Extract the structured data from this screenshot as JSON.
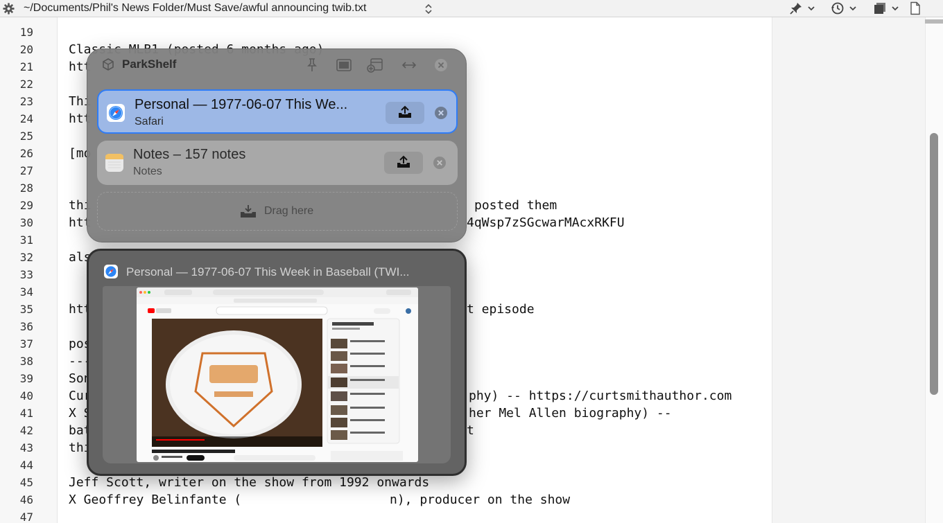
{
  "titlebar": {
    "path": "~/Documents/Phil's News Folder/Must Save/awful announcing twib.txt"
  },
  "editor": {
    "line_numbers": [
      "19",
      "20",
      "21",
      "22",
      "23",
      "24",
      "25",
      "26",
      "27",
      "28",
      "29",
      "30",
      "31",
      "32",
      "33",
      "34",
      "35",
      "36",
      "37",
      "38",
      "39",
      "40",
      "41",
      "42",
      "43",
      "44",
      "45",
      "46",
      "47"
    ],
    "visible_text": [
      "Classic MLB1 (posted 6 months ago)",
      "htt",
      "Thi",
      "htt",
      "[mo",
      "thi",
      "posted them",
      "htt",
      "4qWsp7zSGcwarMAcxRKFU",
      "als",
      "htt",
      "t episode",
      "pos",
      "---",
      "Son",
      "Cur",
      "phy) -- https://curtsmithauthor.com",
      "X S",
      "her Mel Allen biography) --",
      "bat",
      "t",
      "thi",
      "Jeff Scott, writer on the show from 1992 onwards",
      "X Geoffrey Belinfante (",
      "n), producer on the show"
    ]
  },
  "shelf": {
    "title": "ParkShelf",
    "items": [
      {
        "title": "Personal — 1977-06-07 This We...",
        "subtitle": "Safari",
        "selected": true
      },
      {
        "title": "Notes – 157 notes",
        "subtitle": "Notes",
        "selected": false
      }
    ],
    "drop_label": "Drag here"
  },
  "preview": {
    "title": "Personal — 1977-06-07 This Week in Baseball (TWI..."
  },
  "colors": {
    "selection_fill": "#9db8e6",
    "selection_border": "#2f7cf6",
    "shelf_bg": "#808080",
    "preview_bg": "#636363"
  }
}
